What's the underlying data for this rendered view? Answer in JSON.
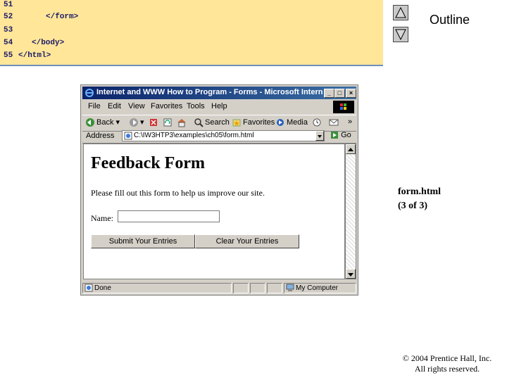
{
  "code": {
    "lines": [
      {
        "num": "51",
        "text": ""
      },
      {
        "num": "52",
        "text": "</form>"
      },
      {
        "num": "53",
        "text": ""
      },
      {
        "num": "54",
        "text": "</body>"
      },
      {
        "num": "55",
        "text": "</html>"
      }
    ]
  },
  "nav": {
    "outline_label": "Outline",
    "up_icon": "triangle-up-icon",
    "down_icon": "triangle-down-icon"
  },
  "caption": {
    "file": "form.html",
    "page": "(3 of 3)"
  },
  "copyright": {
    "line1": "© 2004 Prentice Hall, Inc.",
    "line2": "All rights reserved."
  },
  "browser": {
    "title": "Internet and WWW How to Program - Forms - Microsoft Internet E...",
    "title_buttons": [
      "_",
      "□",
      "×"
    ],
    "menu": [
      "File",
      "Edit",
      "View",
      "Favorites",
      "Tools",
      "Help"
    ],
    "toolbar": {
      "back": "Back",
      "search": "Search",
      "favorites": "Favorites",
      "media": "Media",
      "chevron": "»"
    },
    "address_label": "Address",
    "address_value": "C:\\IW3HTP3\\examples\\ch05\\form.html",
    "go_label": "Go",
    "status_text": "Done",
    "zone_text": "My Computer"
  },
  "page": {
    "heading": "Feedback Form",
    "intro": "Please fill out this form to help us improve our site.",
    "name_label": "Name:",
    "name_value": "",
    "submit_label": "Submit Your Entries",
    "reset_label": "Clear Your Entries"
  },
  "colors": {
    "code_bg": "#ffe699",
    "code_text": "#1a1a66",
    "title_bar": "#0a246a",
    "chrome": "#d4d0c8"
  }
}
